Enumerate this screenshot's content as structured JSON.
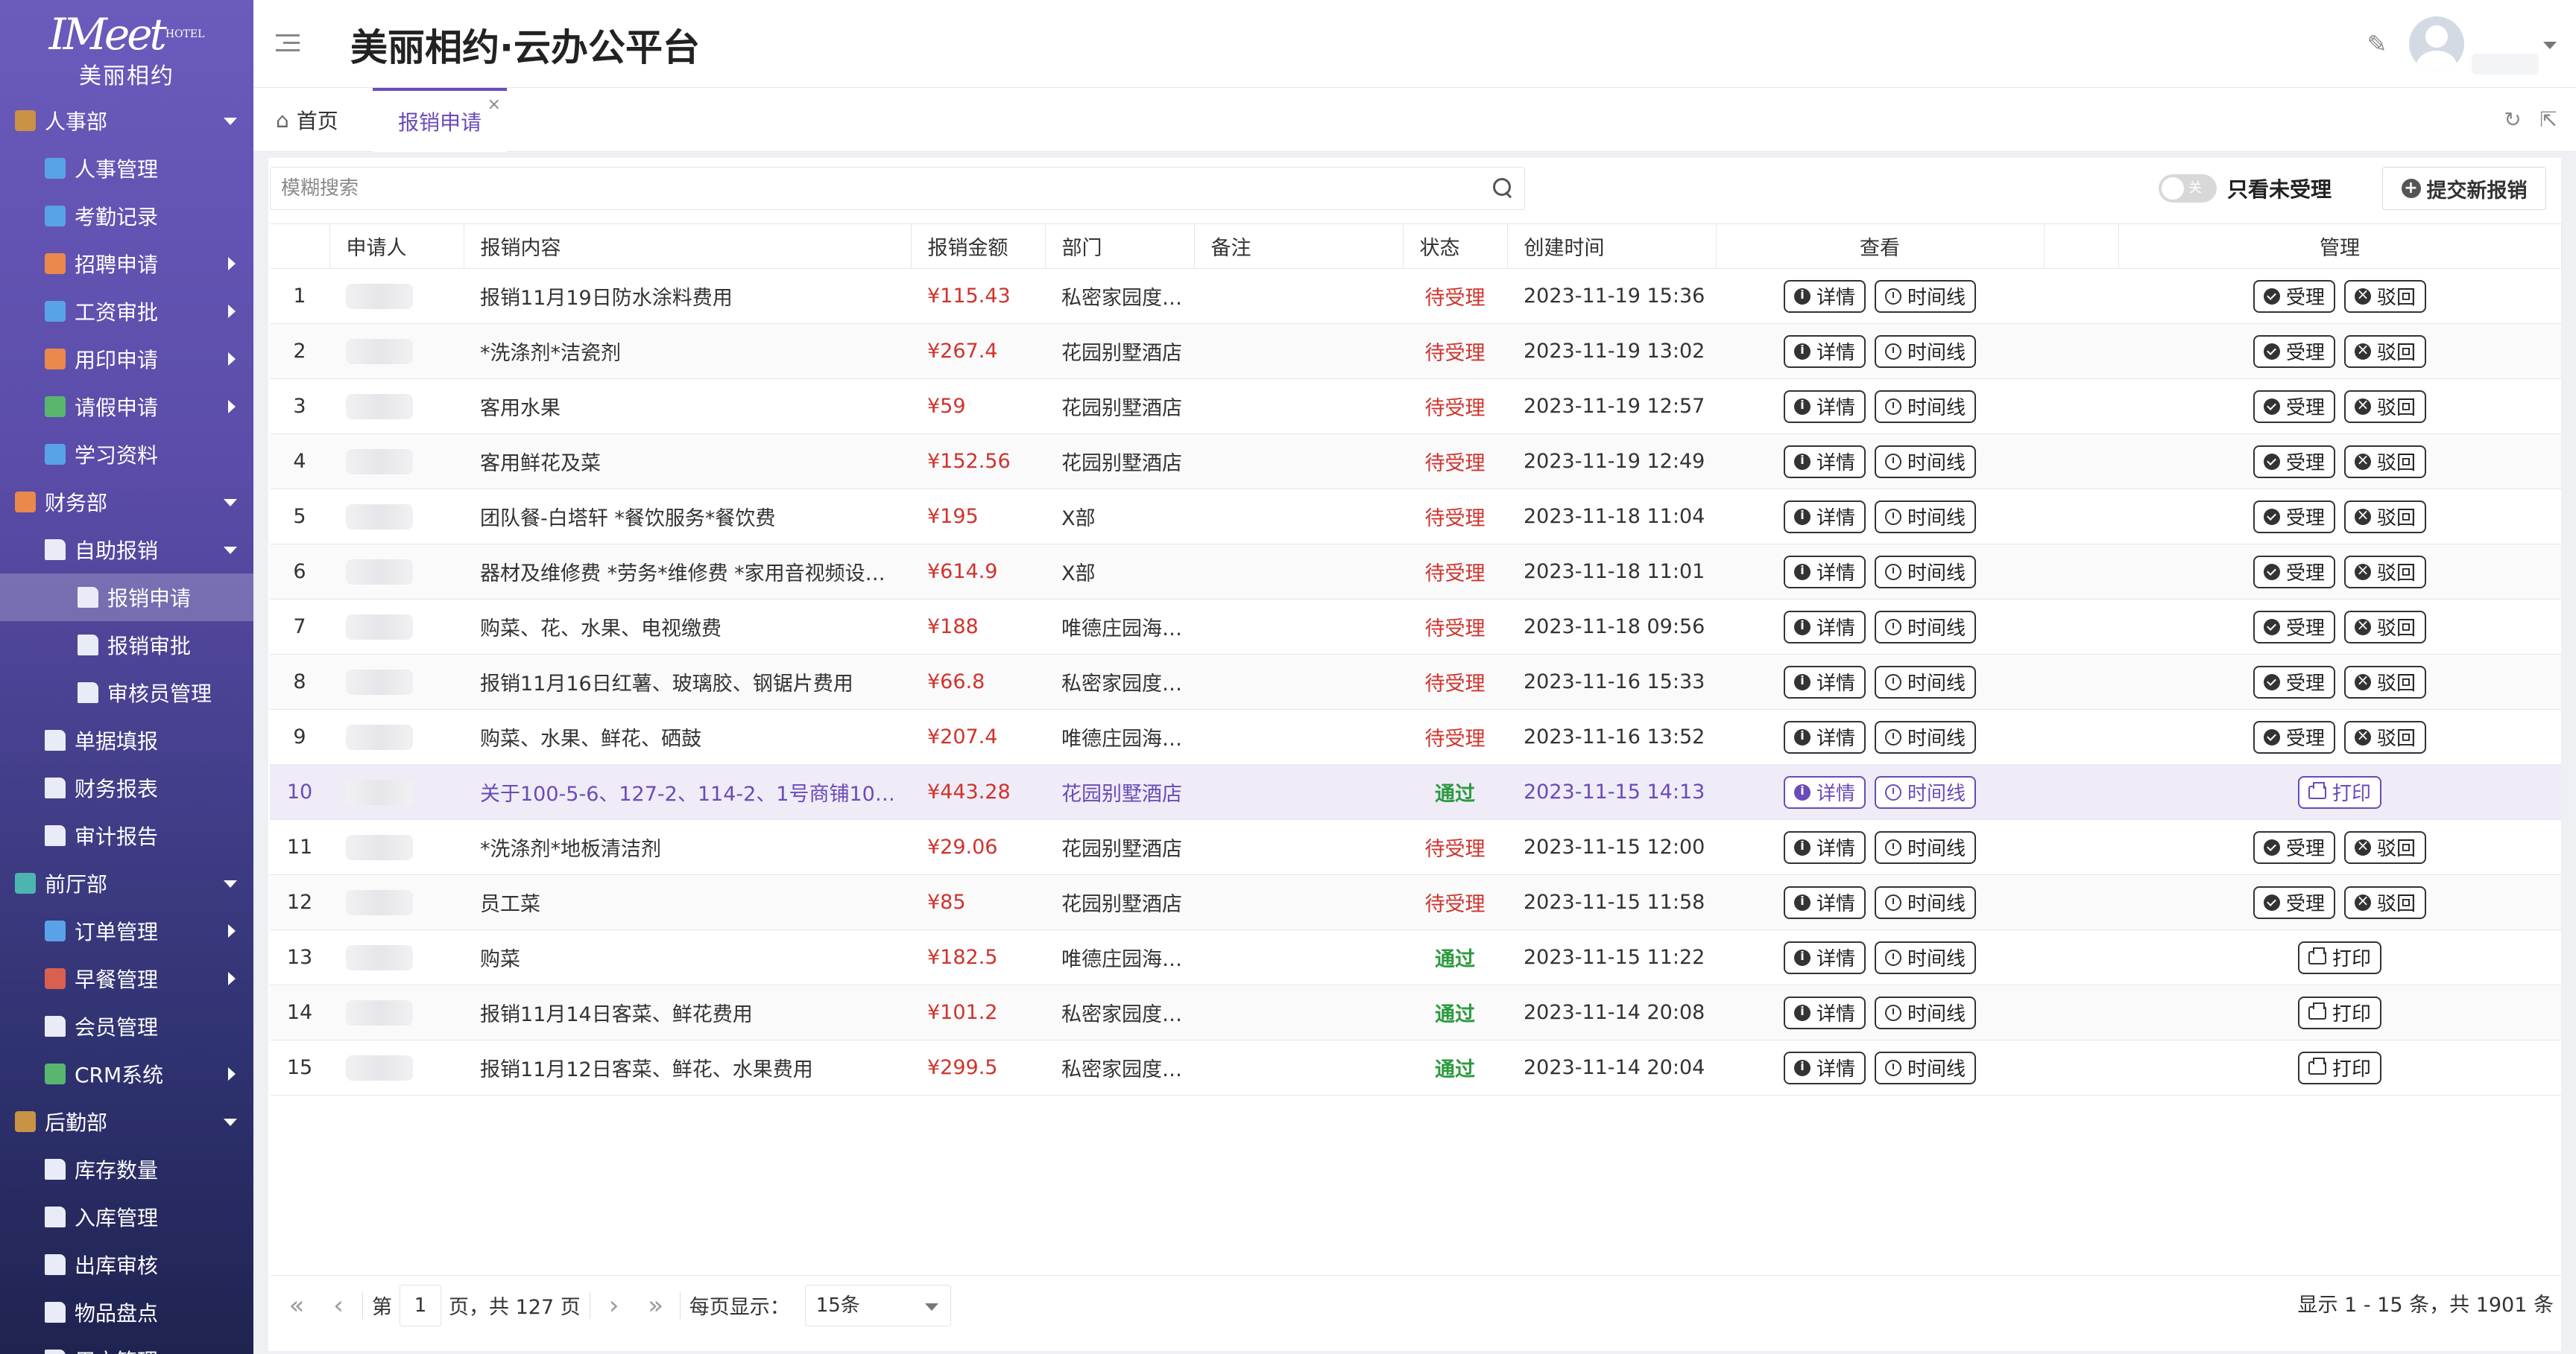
{
  "app": {
    "title": "美丽相约·云办公平台",
    "logo_main": "IMeet",
    "logo_small": "HOTEL",
    "logo_cn": "美丽相约"
  },
  "sidebar": {
    "items": [
      {
        "label": "人事部",
        "level": 0,
        "icon": "book-icon",
        "arrow": "down"
      },
      {
        "label": "人事管理",
        "level": 1,
        "icon": "sitemap-icon",
        "arrow": ""
      },
      {
        "label": "考勤记录",
        "level": 1,
        "icon": "user-clock-icon",
        "arrow": ""
      },
      {
        "label": "招聘申请",
        "level": 1,
        "icon": "folder-icon",
        "arrow": "right"
      },
      {
        "label": "工资审批",
        "level": 1,
        "icon": "calendar-icon",
        "arrow": "right"
      },
      {
        "label": "用印申请",
        "level": 1,
        "icon": "folder-icon",
        "arrow": "right"
      },
      {
        "label": "请假申请",
        "level": 1,
        "icon": "person-icon",
        "arrow": "right"
      },
      {
        "label": "学习资料",
        "level": 1,
        "icon": "notebook-icon",
        "arrow": ""
      },
      {
        "label": "财务部",
        "level": 0,
        "icon": "group-icon",
        "arrow": "down"
      },
      {
        "label": "自助报销",
        "level": 1,
        "icon": "document-icon",
        "arrow": "down"
      },
      {
        "label": "报销申请",
        "level": 2,
        "icon": "document-icon",
        "arrow": "",
        "active": true
      },
      {
        "label": "报销审批",
        "level": 2,
        "icon": "document-icon",
        "arrow": ""
      },
      {
        "label": "审核员管理",
        "level": 2,
        "icon": "document-icon",
        "arrow": ""
      },
      {
        "label": "单据填报",
        "level": 1,
        "icon": "document-icon",
        "arrow": ""
      },
      {
        "label": "财务报表",
        "level": 1,
        "icon": "document-icon",
        "arrow": ""
      },
      {
        "label": "审计报告",
        "level": 1,
        "icon": "document-icon",
        "arrow": ""
      },
      {
        "label": "前厅部",
        "level": 0,
        "icon": "picture-icon",
        "arrow": "down"
      },
      {
        "label": "订单管理",
        "level": 1,
        "icon": "window-icon",
        "arrow": "right"
      },
      {
        "label": "早餐管理",
        "level": 1,
        "icon": "bowl-icon",
        "arrow": "right"
      },
      {
        "label": "会员管理",
        "level": 1,
        "icon": "document-icon",
        "arrow": ""
      },
      {
        "label": "CRM系统",
        "level": 1,
        "icon": "network-icon",
        "arrow": "right"
      },
      {
        "label": "后勤部",
        "level": 0,
        "icon": "book-icon",
        "arrow": "down"
      },
      {
        "label": "库存数量",
        "level": 1,
        "icon": "document-icon",
        "arrow": ""
      },
      {
        "label": "入库管理",
        "level": 1,
        "icon": "document-icon",
        "arrow": ""
      },
      {
        "label": "出库审核",
        "level": 1,
        "icon": "document-icon",
        "arrow": ""
      },
      {
        "label": "物品盘点",
        "level": 1,
        "icon": "document-icon",
        "arrow": ""
      },
      {
        "label": "用户管理",
        "level": 1,
        "icon": "document-icon",
        "arrow": ""
      }
    ]
  },
  "tabs": {
    "home": "首页",
    "active": "报销申请",
    "close_glyph": "×"
  },
  "toolbar": {
    "search_placeholder": "模糊搜索",
    "toggle_state": "关",
    "toggle_label": "只看未受理",
    "new_button": "提交新报销"
  },
  "table": {
    "headers": [
      "申请人",
      "报销内容",
      "报销金额",
      "部门",
      "备注",
      "状态",
      "创建时间",
      "查看",
      "",
      "管理"
    ],
    "btn_detail": "详情",
    "btn_timeline": "时间线",
    "btn_accept": "受理",
    "btn_reject": "驳回",
    "btn_print": "打印",
    "rows": [
      {
        "no": "1",
        "content": "报销11月19日防水涂料费用",
        "amount": "¥115.43",
        "dept": "私密家园度假…",
        "note": "",
        "status": "待受理",
        "created": "2023-11-19 15:36",
        "manage": "pending"
      },
      {
        "no": "2",
        "content": "*洗涤剂*洁瓷剂",
        "amount": "¥267.4",
        "dept": "花园别墅酒店",
        "note": "",
        "status": "待受理",
        "created": "2023-11-19 13:02",
        "manage": "pending"
      },
      {
        "no": "3",
        "content": "客用水果",
        "amount": "¥59",
        "dept": "花园别墅酒店",
        "note": "",
        "status": "待受理",
        "created": "2023-11-19 12:57",
        "manage": "pending"
      },
      {
        "no": "4",
        "content": "客用鲜花及菜",
        "amount": "¥152.56",
        "dept": "花园别墅酒店",
        "note": "",
        "status": "待受理",
        "created": "2023-11-19 12:49",
        "manage": "pending"
      },
      {
        "no": "5",
        "content": "团队餐-白塔轩 *餐饮服务*餐饮费",
        "amount": "¥195",
        "dept": "X部",
        "note": "",
        "status": "待受理",
        "created": "2023-11-18 11:04",
        "manage": "pending"
      },
      {
        "no": "6",
        "content": "器材及维修费 *劳务*维修费 *家用音视频设…",
        "amount": "¥614.9",
        "dept": "X部",
        "note": "",
        "status": "待受理",
        "created": "2023-11-18 11:01",
        "manage": "pending"
      },
      {
        "no": "7",
        "content": "购菜、花、水果、电视缴费",
        "amount": "¥188",
        "dept": "唯德庄园海景…",
        "note": "",
        "status": "待受理",
        "created": "2023-11-18 09:56",
        "manage": "pending"
      },
      {
        "no": "8",
        "content": "报销11月16日红薯、玻璃胶、钢锯片费用",
        "amount": "¥66.8",
        "dept": "私密家园度假…",
        "note": "",
        "status": "待受理",
        "created": "2023-11-16 15:33",
        "manage": "pending"
      },
      {
        "no": "9",
        "content": "购菜、水果、鲜花、硒鼓",
        "amount": "¥207.4",
        "dept": "唯德庄园海景…",
        "note": "",
        "status": "待受理",
        "created": "2023-11-16 13:52",
        "manage": "pending"
      },
      {
        "no": "10",
        "content": "关于100-5-6、127-2、114-2、1号商铺10…",
        "amount": "¥443.28",
        "dept": "花园别墅酒店",
        "note": "",
        "status": "通过",
        "created": "2023-11-15 14:13",
        "manage": "print",
        "highlight": true
      },
      {
        "no": "11",
        "content": "*洗涤剂*地板清洁剂",
        "amount": "¥29.06",
        "dept": "花园别墅酒店",
        "note": "",
        "status": "待受理",
        "created": "2023-11-15 12:00",
        "manage": "pending"
      },
      {
        "no": "12",
        "content": "员工菜",
        "amount": "¥85",
        "dept": "花园别墅酒店",
        "note": "",
        "status": "待受理",
        "created": "2023-11-15 11:58",
        "manage": "pending"
      },
      {
        "no": "13",
        "content": "购菜",
        "amount": "¥182.5",
        "dept": "唯德庄园海景…",
        "note": "",
        "status": "通过",
        "created": "2023-11-15 11:22",
        "manage": "print"
      },
      {
        "no": "14",
        "content": "报销11月14日客菜、鲜花费用",
        "amount": "¥101.2",
        "dept": "私密家园度假…",
        "note": "",
        "status": "通过",
        "created": "2023-11-14 20:08",
        "manage": "print"
      },
      {
        "no": "15",
        "content": "报销11月12日客菜、鲜花、水果费用",
        "amount": "¥299.5",
        "dept": "私密家园度假…",
        "note": "",
        "status": "通过",
        "created": "2023-11-14 20:04",
        "manage": "print"
      }
    ]
  },
  "pagination": {
    "page_prefix": "第",
    "current_page": "1",
    "page_suffix": "页，共 127 页",
    "per_page_label": "每页显示：",
    "per_page_value": "15条",
    "summary": "显示 1 - 15 条，共 1901 条"
  },
  "colors": {
    "accent": "#6a4bb8",
    "pending": "#d0332c",
    "approved": "#2b9a3e"
  }
}
